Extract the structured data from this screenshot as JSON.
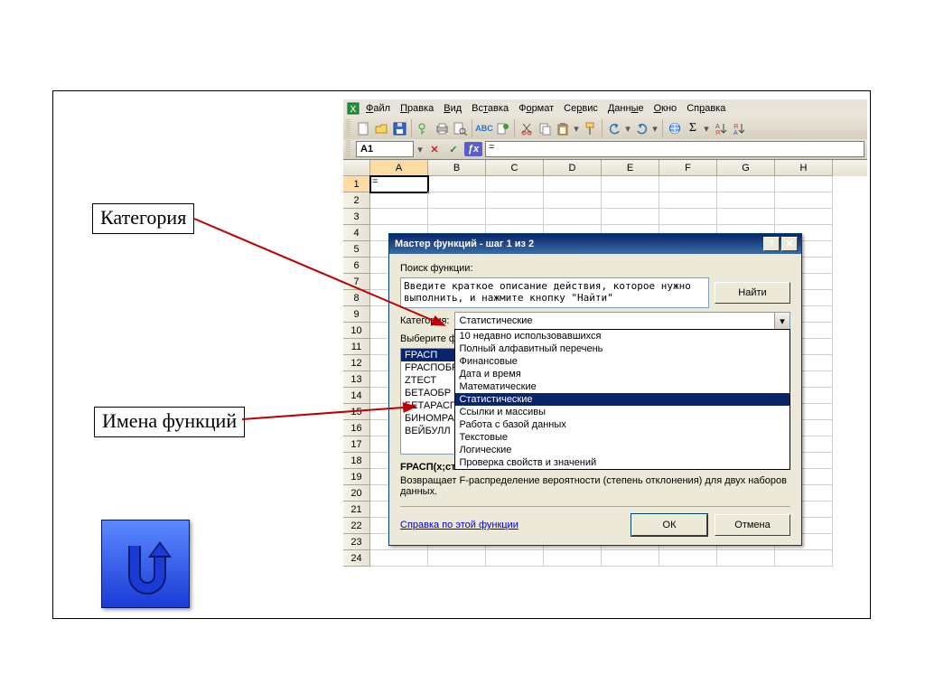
{
  "callouts": {
    "category": "Категория",
    "functions": "Имена функций"
  },
  "menubar": {
    "items": [
      "Файл",
      "Правка",
      "Вид",
      "Вставка",
      "Формат",
      "Сервис",
      "Данные",
      "Окно",
      "Справка"
    ],
    "underline_index": [
      0,
      0,
      0,
      2,
      1,
      2,
      4,
      0,
      2
    ]
  },
  "formula": {
    "cell_ref": "A1",
    "value": "="
  },
  "grid": {
    "columns": [
      "A",
      "B",
      "C",
      "D",
      "E",
      "F",
      "G",
      "H"
    ],
    "row_count": 24,
    "active_cell": "A1",
    "a1_value": "="
  },
  "wizard": {
    "title": "Мастер функций - шаг 1 из 2",
    "search_label": "Поиск функции:",
    "search_text": "Введите краткое описание действия, которое нужно выполнить, и нажмите кнопку \"Найти\"",
    "find_button": "Найти",
    "category_label": "Категория:",
    "category_value": "Статистические",
    "category_options": [
      "10 недавно использовавшихся",
      "Полный алфавитный перечень",
      "Финансовые",
      "Дата и время",
      "Математические",
      "Статистические",
      "Ссылки и массивы",
      "Работа с базой данных",
      "Текстовые",
      "Логические",
      "Проверка свойств и значений"
    ],
    "select_label_prefix": "Выберите фу",
    "function_list": [
      "FРАСП",
      "FРАСПОБР",
      "ZТЕСТ",
      "БЕТАОБР",
      "БЕТАРАСП",
      "БИНОМРАСП",
      "ВЕЙБУЛЛ"
    ],
    "function_selected_index": 0,
    "desc_name": "FРАСП(x;ст",
    "desc_text": "Возвращает F-распределение вероятности (степень отклонения) для двух наборов данных.",
    "help_link": "Справка по этой функции",
    "ok_button": "ОК",
    "cancel_button": "Отмена"
  },
  "toolbar_icons": {
    "new": "□",
    "open": "📂",
    "save": "💾",
    "perm": "🔒",
    "print": "🖨",
    "preview": "🔍",
    "spell": "ABC",
    "research": "ⓘ",
    "cut": "✂",
    "copy": "⧉",
    "paste": "📋",
    "fmtpaint": "🖌",
    "undo": "↶",
    "redo": "↷",
    "link": "🔗",
    "sum": "Σ",
    "sort_asc": "A↓",
    "sort_desc": "Я↓"
  },
  "colors": {
    "title_blue": "#0a246a",
    "sel_blue": "#0a246a",
    "arrow": "#c00000"
  }
}
